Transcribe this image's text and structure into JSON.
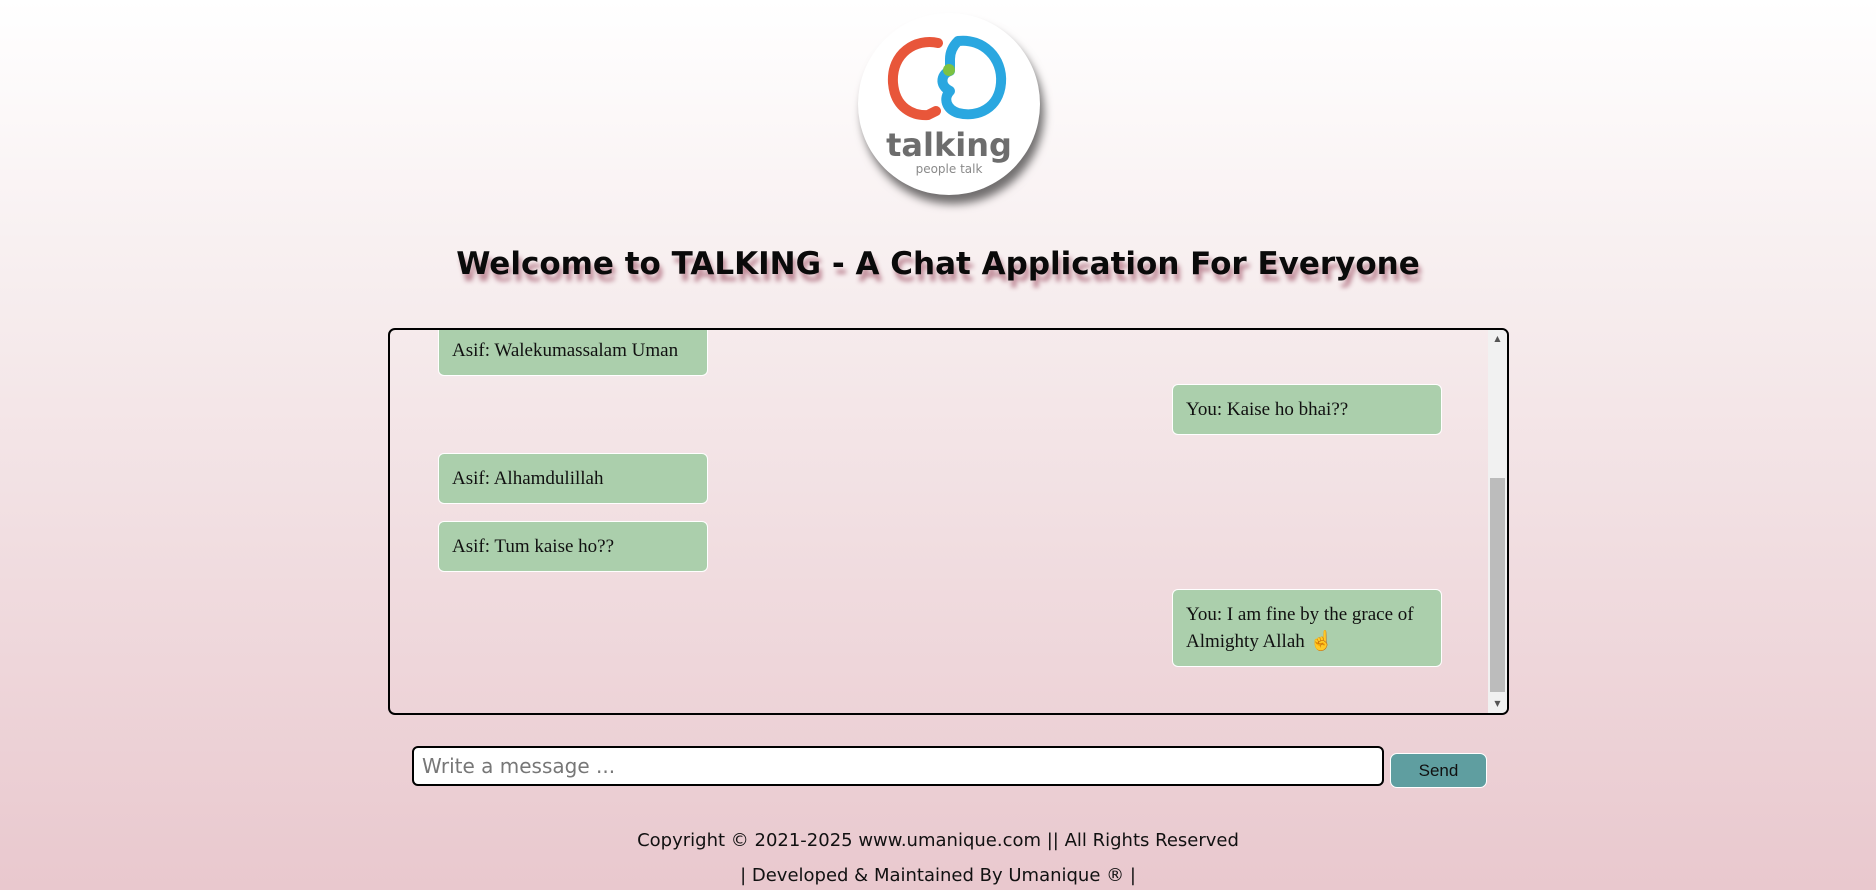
{
  "logo": {
    "wordmark": "talking",
    "tagline": "people talk"
  },
  "header": {
    "title": "Welcome to TALKING - A Chat Application For Everyone"
  },
  "chat": {
    "messages": [
      {
        "side": "left",
        "text": "Asif: Walekumassalam Uman"
      },
      {
        "side": "right",
        "text": "You: Kaise ho bhai??"
      },
      {
        "side": "left",
        "text": "Asif: Alhamdulillah"
      },
      {
        "side": "left",
        "text": "Asif: Tum kaise ho??"
      },
      {
        "side": "right",
        "text": "You: I am fine by the grace of Almighty Allah ☝"
      }
    ]
  },
  "composer": {
    "placeholder": "Write a message ...",
    "value": "",
    "send_label": "Send"
  },
  "footer": {
    "copyright": "Copyright © 2021-2025 www.umanique.com || All Rights Reserved",
    "developer": "| Developed & Maintained By Umanique ® |"
  },
  "colors": {
    "bubble": "#abcfac",
    "send_button": "#5f9ea0",
    "title_shadow": "#c08c99"
  }
}
